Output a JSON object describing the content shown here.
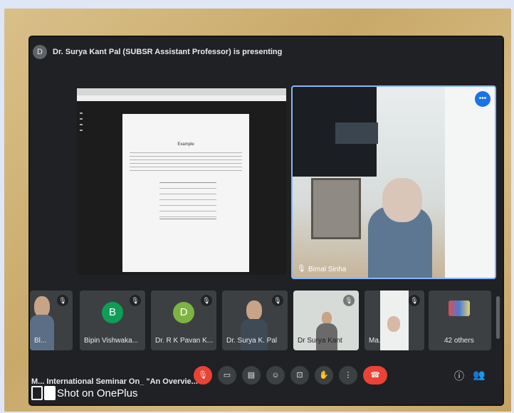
{
  "header": {
    "presenting_text": "Dr. Surya Kant Pal (SUBSR Assistant Professor) is presenting",
    "avatar_letter": "D"
  },
  "presentation": {
    "doc_title": "Example"
  },
  "main_speaker": {
    "name": "Bimal Sinha",
    "more_label": "•••"
  },
  "participants": [
    {
      "name": "Bl..."
    },
    {
      "name": "Bipin Vishwaka...",
      "initial": "B",
      "color": "#0f9d58"
    },
    {
      "name": "Dr. R K Pavan K...",
      "initial": "D",
      "color": "#7cb342"
    },
    {
      "name": "Dr. Surya K. Pal"
    },
    {
      "name": "Dr Surya Kant"
    },
    {
      "name": "Ma..."
    },
    {
      "name": "42 others"
    }
  ],
  "footer": {
    "meeting_title": "M... International Seminar On_ \"An Overvie...",
    "watermark": "Shot on OnePlus"
  },
  "controls": {
    "mic": "🎙",
    "cam": "▭",
    "cc": "▤",
    "emoji": "☺",
    "present": "⊡",
    "hand": "✋",
    "more": "⋮",
    "end": "☎"
  },
  "right_controls": {
    "info": "ⓘ",
    "people": "👥"
  }
}
